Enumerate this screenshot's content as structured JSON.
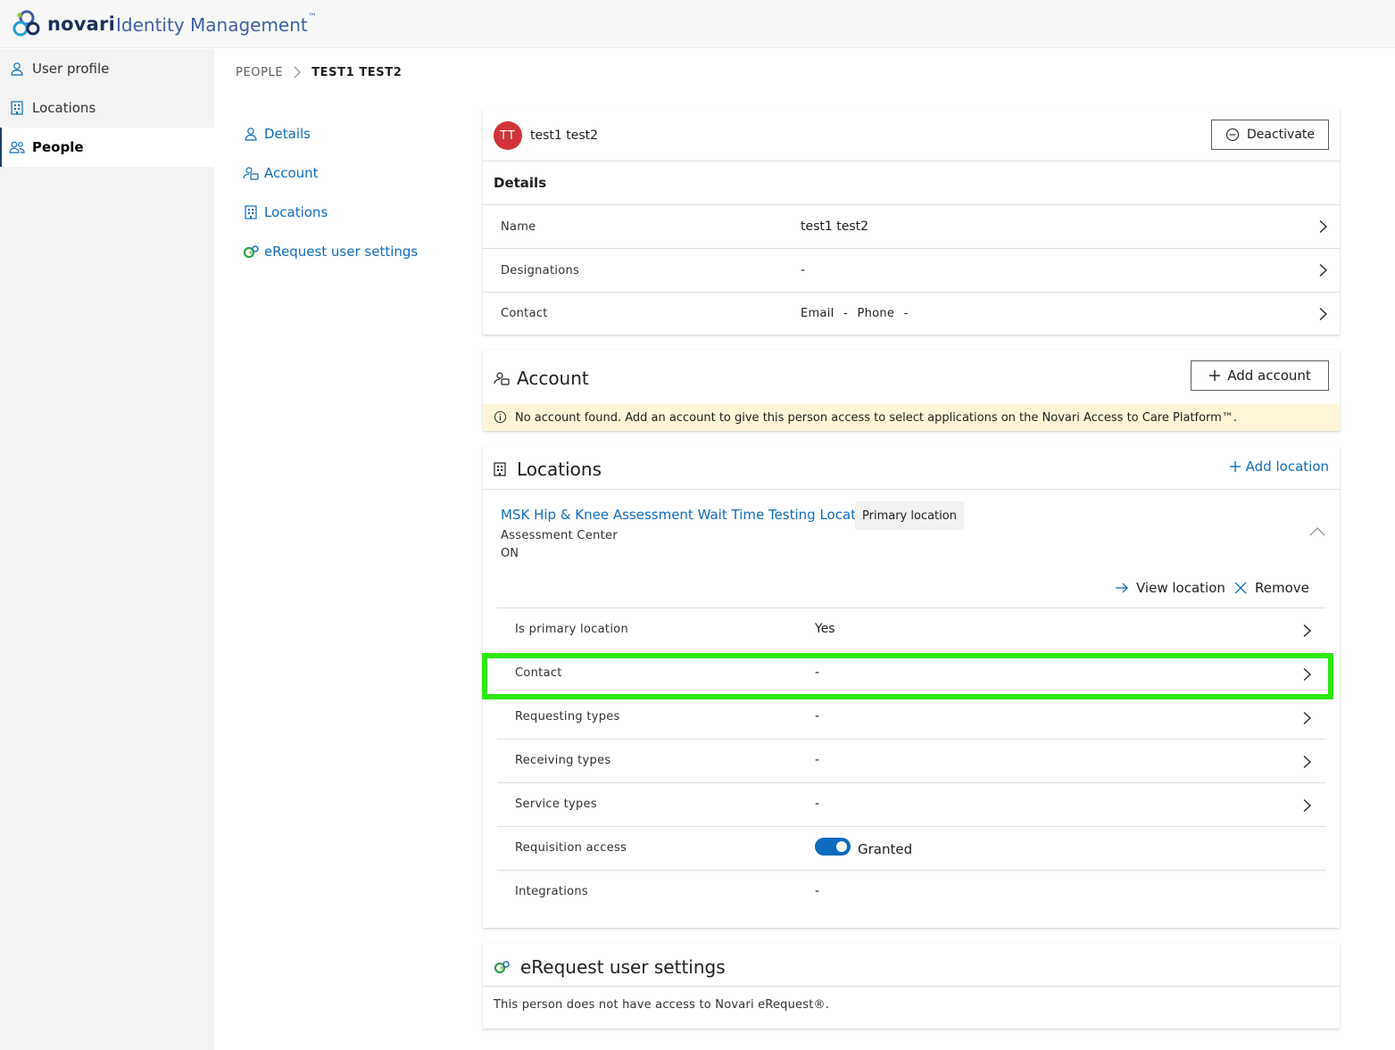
{
  "header": {
    "brand": "novari",
    "product": "Identity Management",
    "tm": "™"
  },
  "leftnav": {
    "items": [
      {
        "label": "User profile",
        "icon": "person-icon"
      },
      {
        "label": "Locations",
        "icon": "building-icon"
      },
      {
        "label": "People",
        "icon": "people-icon",
        "active": true
      }
    ]
  },
  "breadcrumb": {
    "parent": "PEOPLE",
    "current": "TEST1 TEST2"
  },
  "section_nav": {
    "items": [
      {
        "label": "Details",
        "icon": "person-icon"
      },
      {
        "label": "Account",
        "icon": "account-icon"
      },
      {
        "label": "Locations",
        "icon": "building-icon"
      },
      {
        "label": "eRequest user settings",
        "icon": "erequest-icon"
      }
    ]
  },
  "details_card": {
    "avatar_initials": "TT",
    "person_name": "test1  test2",
    "deactivate_label": "Deactivate",
    "section_title": "Details",
    "rows": [
      {
        "label": "Name",
        "value": "test1  test2"
      },
      {
        "label": "Designations",
        "value": "-"
      },
      {
        "label": "Contact",
        "email_label": "Email",
        "email_value": "-",
        "phone_label": "Phone",
        "phone_value": "-"
      }
    ]
  },
  "account_card": {
    "title": "Account",
    "add_label": "Add account",
    "warning": "No account found. Add an account to give this person access to select applications on the Novari Access to Care Platform™."
  },
  "locations_card": {
    "title": "Locations",
    "add_label": "Add location",
    "location": {
      "name": "MSK Hip & Knee Assessment Wait Time Testing Location",
      "badge": "Primary location",
      "type": "Assessment Center",
      "province": "ON",
      "view_label": "View location",
      "remove_label": "Remove"
    },
    "rows": [
      {
        "label": "Is primary location",
        "value": "Yes"
      },
      {
        "label": "Contact",
        "value": "-"
      },
      {
        "label": "Requesting types",
        "value": "-"
      },
      {
        "label": "Receiving types",
        "value": "-"
      },
      {
        "label": "Service types",
        "value": "-"
      },
      {
        "label": "Requisition access",
        "value": "Granted",
        "toggle_on": true
      },
      {
        "label": "Integrations",
        "value": "-"
      }
    ]
  },
  "erequest_card": {
    "title": "eRequest user settings",
    "message": "This person does not have access to Novari eRequest®."
  },
  "colors": {
    "accent": "#0f6cbd",
    "highlight": "#2ee80f",
    "avatar": "#d13438",
    "warning_bg": "#fff6d9"
  }
}
